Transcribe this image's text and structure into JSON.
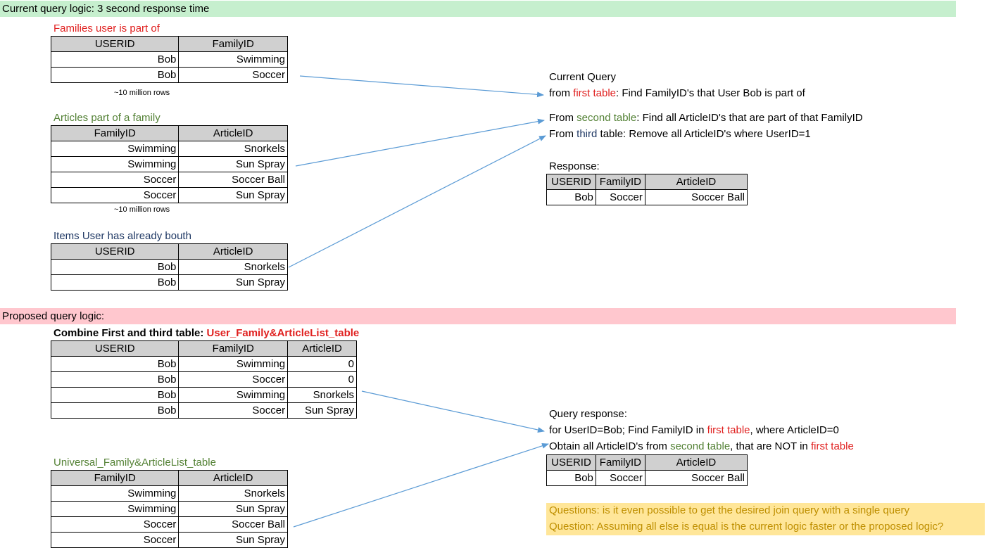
{
  "banners": {
    "current": "Current query logic: 3 second response time",
    "proposed": "Proposed query logic:"
  },
  "current": {
    "families": {
      "title": "Families user is part of",
      "headers": [
        "USERID",
        "FamilyID"
      ],
      "rows": [
        [
          "Bob",
          "Swimming"
        ],
        [
          "Bob",
          "Soccer"
        ]
      ],
      "note": "~10 million rows"
    },
    "articles": {
      "title": "Articles part of a family",
      "headers": [
        "FamilyID",
        "ArticleID"
      ],
      "rows": [
        [
          "Swimming",
          "Snorkels"
        ],
        [
          "Swimming",
          "Sun Spray"
        ],
        [
          "Soccer",
          "Soccer Ball"
        ],
        [
          "Soccer",
          "Sun Spray"
        ]
      ],
      "note": "~10 million rows"
    },
    "bought": {
      "title": "Items User has already bouth",
      "headers": [
        "USERID",
        "ArticleID"
      ],
      "rows": [
        [
          "Bob",
          "Snorkels"
        ],
        [
          "Bob",
          "Sun Spray"
        ]
      ]
    },
    "explain": {
      "heading": "Current Query",
      "l1_pre": "from ",
      "l1_hl": "first table",
      "l1_post": ": Find FamilyID's that User Bob is part of",
      "l2_pre": "From ",
      "l2_hl": "second table",
      "l2_post": ": Find all ArticleID's that are part of that FamilyID",
      "l3_pre": "From ",
      "l3_hl": "third",
      "l3_post": " table: Remove all ArticleID's where UserID=1"
    },
    "response": {
      "label": "Response:",
      "headers": [
        "USERID",
        "FamilyID",
        "ArticleID"
      ],
      "rows": [
        [
          "Bob",
          "Soccer",
          "Soccer Ball"
        ]
      ]
    }
  },
  "proposed": {
    "combined": {
      "title_pre": "Combine First and third table: ",
      "title_hl": "User_Family&ArticleList_table",
      "headers": [
        "USERID",
        "FamilyID",
        "ArticleID"
      ],
      "rows": [
        [
          "Bob",
          "Swimming",
          "0"
        ],
        [
          "Bob",
          "Soccer",
          "0"
        ],
        [
          "Bob",
          "Swimming",
          "Snorkels"
        ],
        [
          "Bob",
          "Soccer",
          "Sun Spray"
        ]
      ]
    },
    "universal": {
      "title": "Universal_Family&ArticleList_table",
      "headers": [
        "FamilyID",
        "ArticleID"
      ],
      "rows": [
        [
          "Swimming",
          "Snorkels"
        ],
        [
          "Swimming",
          "Sun Spray"
        ],
        [
          "Soccer",
          "Soccer Ball"
        ],
        [
          "Soccer",
          "Sun Spray"
        ]
      ]
    },
    "explain": {
      "heading": "Query response:",
      "l1_pre": "for UserID=Bob; Find FamilyID in ",
      "l1_hl": "first table",
      "l1_post": ", where ArticleID=0",
      "l2_pre": "Obtain all ArticleID's from ",
      "l2_hl": "second table",
      "l2_mid": ", that are NOT in ",
      "l2_hl2": "first table"
    },
    "response": {
      "headers": [
        "USERID",
        "FamilyID",
        "ArticleID"
      ],
      "rows": [
        [
          "Bob",
          "Soccer",
          "Soccer Ball"
        ]
      ]
    }
  },
  "questions": {
    "q1": "Questions: is it even possible to get the desired join query with a single query",
    "q2": "Question: Assuming all else is equal is the current logic faster or the proposed logic?"
  },
  "colors": {
    "arrow": "#5b9bd5",
    "green_banner": "#c6efce",
    "red_banner": "#ffc7ce",
    "question_bg": "#ffe699",
    "question_text": "#bf8f00",
    "highlight_red": "#e0201f",
    "highlight_green": "#538135"
  }
}
